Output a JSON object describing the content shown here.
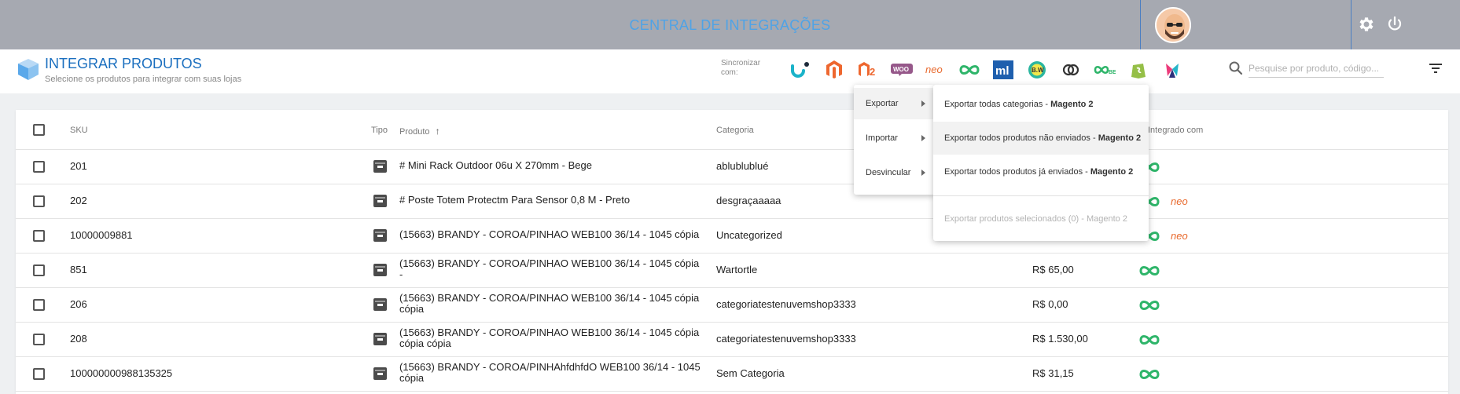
{
  "topbar": {
    "title": "CENTRAL DE INTEGRAÇÕES"
  },
  "header": {
    "title": "INTEGRAR PRODUTOS",
    "subtitle": "Selecione os produtos para integrar com suas lojas",
    "sync_label": "Sincronizar com:",
    "search_placeholder": "Pesquise por produto, código...",
    "stores": [
      "u-store",
      "magento",
      "magento-2",
      "woocommerce",
      "neo",
      "nuvemshop",
      "mercado-livre",
      "b2w",
      "link",
      "nuvemshop-2",
      "shopify",
      "tray"
    ]
  },
  "table": {
    "headers": {
      "sku": "SKU",
      "tipo": "Tipo",
      "produto": "Produto",
      "categoria": "Categoria",
      "integrado": "Integrado com"
    },
    "rows": [
      {
        "sku": "201",
        "produto": "# Mini Rack Outdoor 06u X 270mm - Bege",
        "produto2": "",
        "categoria": "ablublublué",
        "preco": "",
        "integrations": [
          "nuvemshop"
        ]
      },
      {
        "sku": "202",
        "produto": "# Poste Totem Protectm Para Sensor 0,8 M - Preto",
        "produto2": "",
        "categoria": "desgraçaaaaa",
        "preco": "",
        "integrations": [
          "nuvemshop",
          "neo"
        ]
      },
      {
        "sku": "10000009881",
        "produto": "(15663) BRANDY - COROA/PINHAO WEB100 36/14 - 1045 cópia",
        "produto2": "",
        "categoria": "Uncategorized",
        "preco": "",
        "integrations": [
          "nuvemshop",
          "neo"
        ]
      },
      {
        "sku": "851",
        "produto": "(15663) BRANDY - COROA/PINHAO WEB100 36/14 - 1045 cópia",
        "produto2": "-",
        "categoria": "Wartortle",
        "preco": "R$ 65,00",
        "integrations": [
          "nuvemshop"
        ]
      },
      {
        "sku": "206",
        "produto": "(15663) BRANDY - COROA/PINHAO WEB100 36/14 - 1045 cópia",
        "produto2": "cópia",
        "categoria": "categoriatestenuvemshop3333",
        "preco": "R$ 0,00",
        "integrations": [
          "nuvemshop"
        ]
      },
      {
        "sku": "208",
        "produto": "(15663) BRANDY - COROA/PINHAO WEB100 36/14 - 1045 cópia",
        "produto2": "cópia cópia",
        "categoria": "categoriatestenuvemshop3333",
        "preco": "R$ 1.530,00",
        "integrations": [
          "nuvemshop"
        ]
      },
      {
        "sku": "100000000988135325",
        "produto": "(15663) BRANDY - COROA/PINHAhfdhfdO WEB100 36/14 - 1045",
        "produto2": "cópia",
        "categoria": "Sem Categoria",
        "preco": "R$ 31,15",
        "integrations": [
          "nuvemshop"
        ]
      }
    ]
  },
  "menu": {
    "items": [
      "Exportar",
      "Importar",
      "Desvincular"
    ],
    "submenu": [
      {
        "text": "Exportar todas categorias - ",
        "bold": "Magento 2"
      },
      {
        "text": "Exportar todos produtos não enviados - ",
        "bold": "Magento 2"
      },
      {
        "text": "Exportar todos produtos já enviados - ",
        "bold": "Magento 2"
      },
      {
        "text": "Exportar produtos selecionados (0) - Magento 2",
        "bold": ""
      }
    ]
  },
  "colors": {
    "topbar": "#a6a9b1",
    "title_blue": "#1b6fbf",
    "nuvemshop_green": "#2fb56a",
    "neo_orange": "#e8692d"
  }
}
